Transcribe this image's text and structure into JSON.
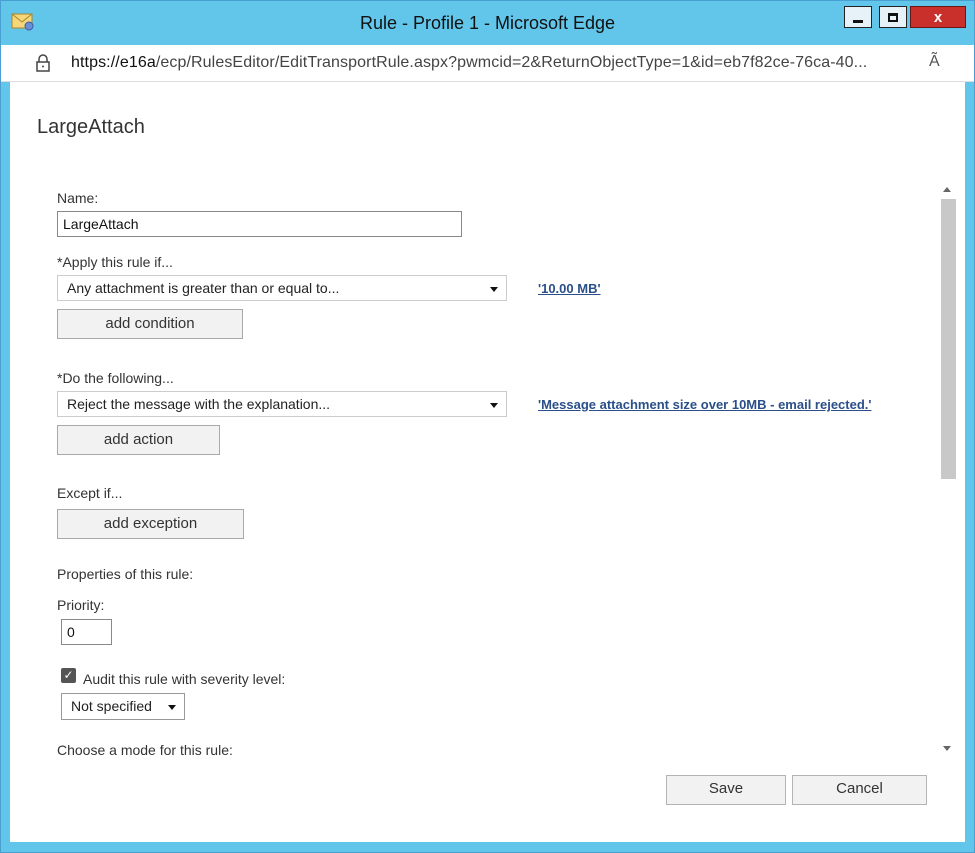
{
  "window": {
    "title": "Rule - Profile 1 - Microsoft Edge",
    "close_glyph": "x"
  },
  "address_bar": {
    "url_host": "https://e16a",
    "url_rest": "/ecp/RulesEditor/EditTransportRule.aspx?pwmcid=2&ReturnObjectType=1&id=eb7f82ce-76ca-40...",
    "read_aloud_glyph": "Ã"
  },
  "page": {
    "title": "LargeAttach"
  },
  "form": {
    "name_label": "Name:",
    "name_value": "LargeAttach",
    "apply_label": "*Apply this rule if...",
    "condition_select": "Any attachment is greater than or equal to...",
    "condition_value_link": "'10.00 MB'",
    "add_condition": "add condition",
    "do_label": "*Do the following...",
    "action_select": "Reject the message with the explanation...",
    "action_value_link": "'Message attachment size over 10MB - email rejected.'",
    "add_action": "add action",
    "except_label": "Except if...",
    "add_exception": "add exception",
    "properties_label": "Properties of this rule:",
    "priority_label": "Priority:",
    "priority_value": "0",
    "audit_checked": true,
    "audit_label": "Audit this rule with severity level:",
    "severity_select": "Not specified",
    "mode_label": "Choose a mode for this rule:"
  },
  "footer": {
    "save": "Save",
    "cancel": "Cancel"
  },
  "colors": {
    "titlebar": "#62c6ea",
    "link": "#2a4f8a",
    "close_button": "#c9302c"
  }
}
